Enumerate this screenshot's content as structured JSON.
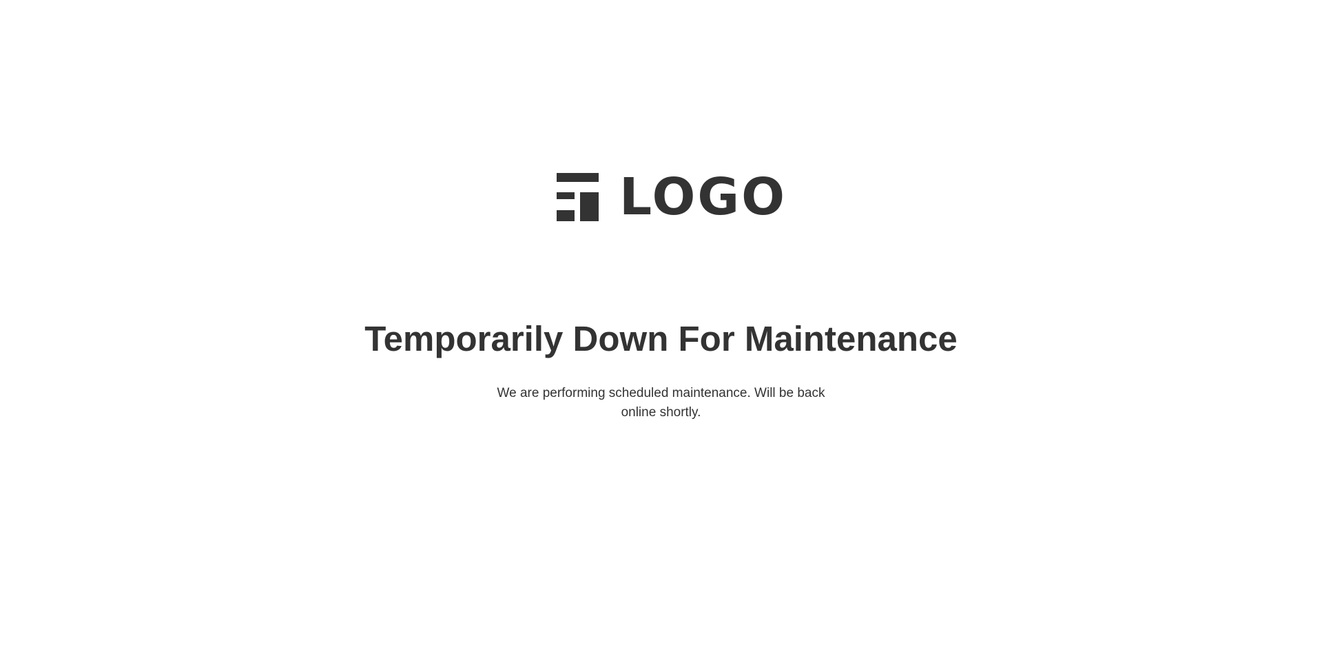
{
  "logo": {
    "icon": "logo-mark-icon",
    "text": "LOGO",
    "color": "#333333"
  },
  "main": {
    "title": "Temporarily Down For Maintenance",
    "message": "We are performing scheduled maintenance. Will be back online shortly."
  },
  "colors": {
    "background": "#ffffff",
    "text": "#333333"
  }
}
